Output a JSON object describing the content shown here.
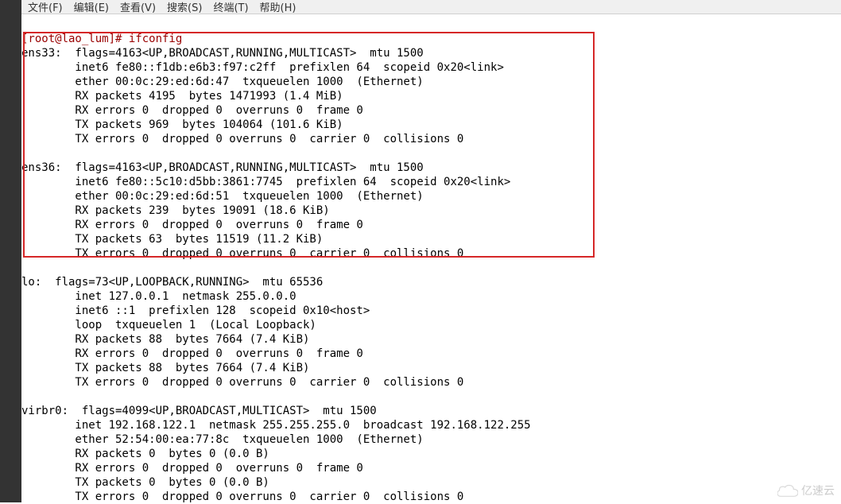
{
  "menu": {
    "file": "文件(F)",
    "edit": "编辑(E)",
    "view": "查看(V)",
    "search": "搜索(S)",
    "terminal": "终端(T)",
    "help": "帮助(H)"
  },
  "prompt": "[root@lao_lum]# ifconfig",
  "ifconfig": {
    "ens33": {
      "header": "ens33:  flags=4163<UP,BROADCAST,RUNNING,MULTICAST>  mtu 1500",
      "inet6": "        inet6 fe80::f1db:e6b3:f97:c2ff  prefixlen 64  scopeid 0x20<link>",
      "ether": "        ether 00:0c:29:ed:6d:47  txqueuelen 1000  (Ethernet)",
      "rxp": "        RX packets 4195  bytes 1471993 (1.4 MiB)",
      "rxe": "        RX errors 0  dropped 0  overruns 0  frame 0",
      "txp": "        TX packets 969  bytes 104064 (101.6 KiB)",
      "txe": "        TX errors 0  dropped 0 overruns 0  carrier 0  collisions 0"
    },
    "ens36": {
      "header": "ens36:  flags=4163<UP,BROADCAST,RUNNING,MULTICAST>  mtu 1500",
      "inet6": "        inet6 fe80::5c10:d5bb:3861:7745  prefixlen 64  scopeid 0x20<link>",
      "ether": "        ether 00:0c:29:ed:6d:51  txqueuelen 1000  (Ethernet)",
      "rxp": "        RX packets 239  bytes 19091 (18.6 KiB)",
      "rxe": "        RX errors 0  dropped 0  overruns 0  frame 0",
      "txp": "        TX packets 63  bytes 11519 (11.2 KiB)",
      "txe": "        TX errors 0  dropped 0 overruns 0  carrier 0  collisions 0"
    },
    "lo": {
      "header": "lo:  flags=73<UP,LOOPBACK,RUNNING>  mtu 65536",
      "inet": "        inet 127.0.0.1  netmask 255.0.0.0",
      "inet6": "        inet6 ::1  prefixlen 128  scopeid 0x10<host>",
      "loop": "        loop  txqueuelen 1  (Local Loopback)",
      "rxp": "        RX packets 88  bytes 7664 (7.4 KiB)",
      "rxe": "        RX errors 0  dropped 0  overruns 0  frame 0",
      "txp": "        TX packets 88  bytes 7664 (7.4 KiB)",
      "txe": "        TX errors 0  dropped 0 overruns 0  carrier 0  collisions 0"
    },
    "virbr0": {
      "header": "virbr0:  flags=4099<UP,BROADCAST,MULTICAST>  mtu 1500",
      "inet": "        inet 192.168.122.1  netmask 255.255.255.0  broadcast 192.168.122.255",
      "ether": "        ether 52:54:00:ea:77:8c  txqueuelen 1000  (Ethernet)",
      "rxp": "        RX packets 0  bytes 0 (0.0 B)",
      "rxe": "        RX errors 0  dropped 0  overruns 0  frame 0",
      "txp": "        TX packets 0  bytes 0 (0.0 B)",
      "txe": "        TX errors 0  dropped 0 overruns 0  carrier 0  collisions 0"
    }
  },
  "watermark": "亿速云"
}
